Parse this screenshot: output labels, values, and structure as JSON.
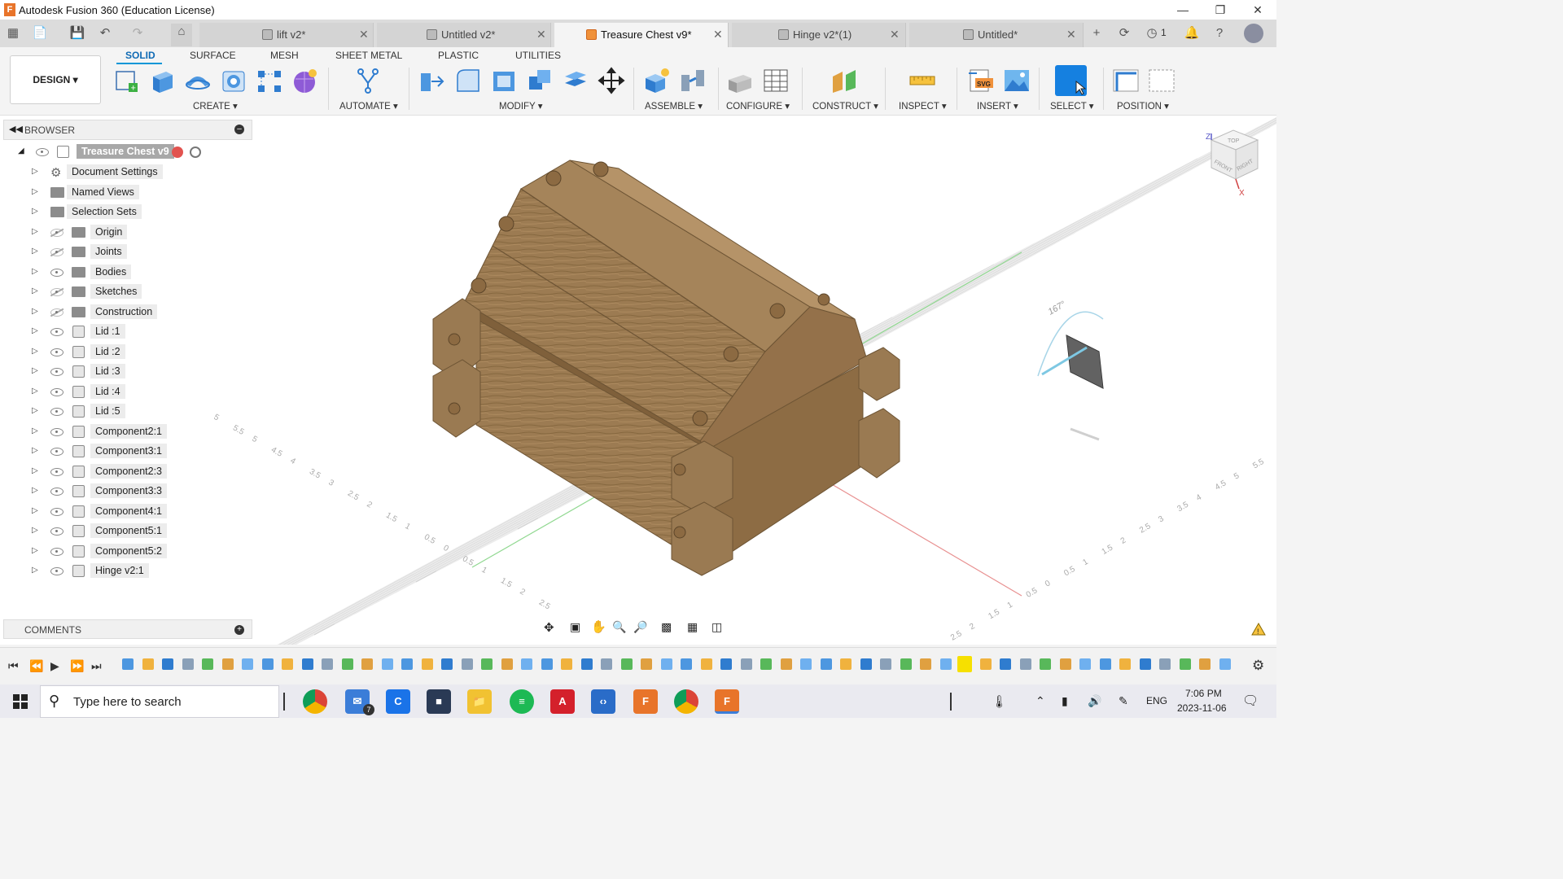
{
  "window": {
    "title": "Autodesk Fusion 360 (Education License)",
    "app_icon": "F",
    "controls": [
      "minimize",
      "restore",
      "close"
    ]
  },
  "tabs": [
    {
      "label": "lift v2*",
      "active": false
    },
    {
      "label": "Untitled v2*",
      "active": false
    },
    {
      "label": "Treasure Chest v9*",
      "active": true
    },
    {
      "label": "Hinge v2*(1)",
      "active": false
    },
    {
      "label": "Untitled*",
      "active": false
    }
  ],
  "tabbar_right": {
    "job_count": "1"
  },
  "workspace": {
    "design_label": "DESIGN ▾"
  },
  "ws_tabs": [
    "SOLID",
    "SURFACE",
    "MESH",
    "SHEET METAL",
    "PLASTIC",
    "UTILITIES"
  ],
  "tool_groups": [
    "CREATE ▾",
    "AUTOMATE ▾",
    "MODIFY ▾",
    "ASSEMBLE ▾",
    "CONFIGURE ▾",
    "CONSTRUCT ▾",
    "INSPECT ▾",
    "INSERT ▾",
    "SELECT ▾",
    "POSITION ▾"
  ],
  "browser": {
    "title": "BROWSER",
    "root": "Treasure Chest v9",
    "items": [
      {
        "label": "Document Settings",
        "icon": "gear-icon",
        "eye": "none"
      },
      {
        "label": "Named Views",
        "icon": "folder-icon",
        "eye": "none"
      },
      {
        "label": "Selection Sets",
        "icon": "folder-icon",
        "eye": "none"
      },
      {
        "label": "Origin",
        "icon": "folder-icon",
        "eye": "hidden"
      },
      {
        "label": "Joints",
        "icon": "folder-icon",
        "eye": "hidden"
      },
      {
        "label": "Bodies",
        "icon": "folder-icon",
        "eye": "visible"
      },
      {
        "label": "Sketches",
        "icon": "folder-icon",
        "eye": "hidden"
      },
      {
        "label": "Construction",
        "icon": "folder-icon",
        "eye": "hidden"
      },
      {
        "label": "Lid :1",
        "icon": "component-icon",
        "eye": "visible"
      },
      {
        "label": "Lid :2",
        "icon": "component-icon",
        "eye": "visible"
      },
      {
        "label": "Lid :3",
        "icon": "component-icon",
        "eye": "visible"
      },
      {
        "label": "Lid :4",
        "icon": "component-icon",
        "eye": "visible"
      },
      {
        "label": "Lid :5",
        "icon": "component-icon",
        "eye": "visible"
      },
      {
        "label": "Component2:1",
        "icon": "component-icon",
        "eye": "visible"
      },
      {
        "label": "Component3:1",
        "icon": "component-icon",
        "eye": "visible"
      },
      {
        "label": "Component2:3",
        "icon": "component-icon",
        "eye": "visible"
      },
      {
        "label": "Component3:3",
        "icon": "component-icon",
        "eye": "visible"
      },
      {
        "label": "Component4:1",
        "icon": "component-icon",
        "eye": "visible"
      },
      {
        "label": "Component5:1",
        "icon": "component-icon",
        "eye": "visible"
      },
      {
        "label": "Component5:2",
        "icon": "component-icon",
        "eye": "visible"
      },
      {
        "label": "Hinge v2:1",
        "icon": "linked-component-icon",
        "eye": "visible"
      }
    ]
  },
  "comments": {
    "title": "COMMENTS"
  },
  "viewcube": {
    "top": "TOP",
    "front": "FRONT",
    "right": "RIGHT",
    "z": "Z",
    "x": "X"
  },
  "viewport": {
    "angle_label": "167°",
    "grid_labels_left": [
      "5",
      "5.5",
      "5",
      "4.5",
      "4",
      "3.5",
      "3",
      "2.5",
      "2",
      "1.5",
      "1",
      "0.5",
      "0",
      "0.5",
      "1",
      "1.5",
      "2",
      "2.5"
    ],
    "grid_labels_right": [
      "2.5",
      "2",
      "1.5",
      "1",
      "0.5",
      "0",
      "0.5",
      "1",
      "1.5",
      "2",
      "2.5",
      "3",
      "3.5",
      "4",
      "4.5",
      "5",
      "5.5"
    ]
  },
  "taskbar": {
    "search_placeholder": "Type here to search",
    "mail_badge": "7",
    "lang": "ENG",
    "time": "7:06 PM",
    "date": "2023-11-06"
  },
  "colors": {
    "accent": "#0696d7",
    "wood": "#9a7a52",
    "brand": "#e8742a"
  }
}
